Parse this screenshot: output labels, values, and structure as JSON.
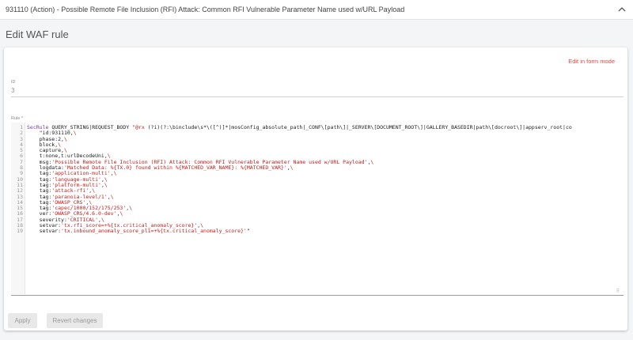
{
  "header": {
    "rule_title": "931110 (Action) - Possible Remote File Inclusion (RFI) Attack: Common RFI Vulnerable Parameter Name used w/URL Payload",
    "collapse_icon": "chevron-up-icon"
  },
  "page": {
    "title": "Edit WAF rule"
  },
  "form": {
    "edit_mode_link": "Edit in form mode",
    "id_label": "ID",
    "id_value": "3",
    "rule_label": "Rule *",
    "resize_grip": "⠿"
  },
  "editor": {
    "line_numbers": [
      "1",
      "2",
      "3",
      "4",
      "5",
      "6",
      "7",
      "8",
      "9",
      "10",
      "11",
      "12",
      "13",
      "14",
      "15",
      "16",
      "17",
      "18",
      "19"
    ],
    "lines": [
      "SecRule QUERY_STRING|REQUEST_BODY \"@rx (?i)(?:\\binclude\\s*\\([^)]*|mosConfig_absolute_path|_CONF\\[path\\]|_SERVER\\[DOCUMENT_ROOT\\]|GALLERY_BASEDIR|path\\[docroot\\]|appserv_root|co",
      "    \"id:931110,\\",
      "    phase:2,\\",
      "    block,\\",
      "    capture,\\",
      "    t:none,t:urlDecodeUni,\\",
      "    msg:'Possible Remote File Inclusion (RFI) Attack: Common RFI Vulnerable Parameter Name used w/URL Payload',\\",
      "    logdata:'Matched Data: %{TX.0} found within %{MATCHED_VAR_NAME}: %{MATCHED_VAR}',\\",
      "    tag:'application-multi',\\",
      "    tag:'language-multi',\\",
      "    tag:'platform-multi',\\",
      "    tag:'attack-rfi',\\",
      "    tag:'paranoia-level/1',\\",
      "    tag:'OWASP_CRS',\\",
      "    tag:'capec/1000/152/175/253',\\",
      "    ver:'OWASP_CRS/4.6.0-dev',\\",
      "    severity:'CRITICAL',\\",
      "    setvar:'tx.rfi_score=+%{tx.critical_anomaly_score}',\\",
      "    setvar:'tx.inbound_anomaly_score_pl1=+%{tx.critical_anomaly_score}'\""
    ]
  },
  "actions": {
    "apply_label": "Apply",
    "revert_label": "Revert changes"
  },
  "colors": {
    "accent_link": "#e8453c",
    "string_token": "#c41a16",
    "keyword_token": "#7a3e9d"
  }
}
